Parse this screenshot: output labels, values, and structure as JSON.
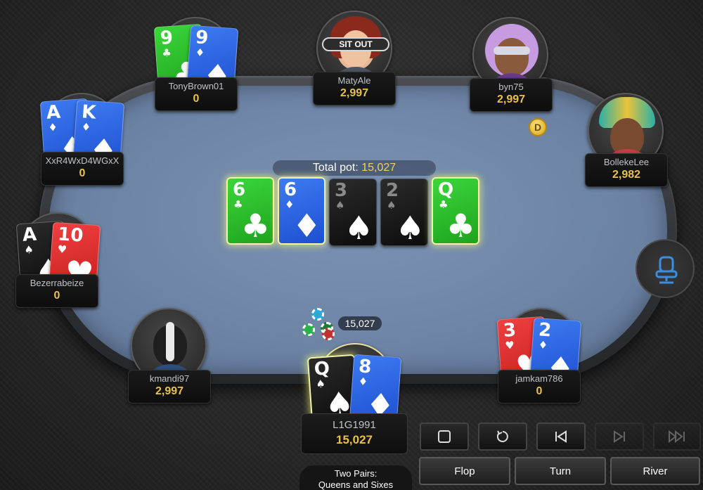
{
  "pot": {
    "label": "Total pot:",
    "value": "15,027"
  },
  "pot_chips_amount": "15,027",
  "board": [
    {
      "rank": "6",
      "suit": "♣",
      "suit_name": "clubs"
    },
    {
      "rank": "6",
      "suit": "♦",
      "suit_name": "diamonds"
    },
    {
      "rank": "3",
      "suit": "♠",
      "suit_name": "spades"
    },
    {
      "rank": "2",
      "suit": "♠",
      "suit_name": "spades"
    },
    {
      "rank": "Q",
      "suit": "♣",
      "suit_name": "clubs"
    }
  ],
  "players": {
    "tonybrown": {
      "name": "TonyBrown01",
      "stack": "0",
      "cards": [
        {
          "rank": "9",
          "suit": "♣"
        },
        {
          "rank": "9",
          "suit": "♦"
        }
      ]
    },
    "matyale": {
      "name": "MatyAle",
      "stack": "2,997",
      "status": "SIT OUT"
    },
    "byn75": {
      "name": "byn75",
      "stack": "2,997"
    },
    "bollekelee": {
      "name": "BollekeLee",
      "stack": "2,982"
    },
    "xxr4": {
      "name": "XxR4WxD4WGxX",
      "stack": "0",
      "cards": [
        {
          "rank": "A",
          "suit": "♦"
        },
        {
          "rank": "K",
          "suit": "♦"
        }
      ]
    },
    "bezerra": {
      "name": "Bezerrabeize",
      "stack": "0",
      "cards": [
        {
          "rank": "A",
          "suit": "♠"
        },
        {
          "rank": "10",
          "suit": "♥"
        }
      ]
    },
    "kmandi": {
      "name": "kmandi97",
      "stack": "2,997"
    },
    "jamkam": {
      "name": "jamkam786",
      "stack": "0",
      "cards": [
        {
          "rank": "3",
          "suit": "♥"
        },
        {
          "rank": "2",
          "suit": "♦"
        }
      ]
    },
    "hero": {
      "name": "L1G1991",
      "stack": "15,027",
      "cards": [
        {
          "rank": "Q",
          "suit": "♠"
        },
        {
          "rank": "8",
          "suit": "♦"
        }
      ]
    }
  },
  "dealer_button": "D",
  "hand_description": {
    "line1": "Two Pairs:",
    "line2": "Queens and Sixes"
  },
  "controls": {
    "stop_icon": "stop-icon",
    "replay_icon": "replay-icon",
    "skip_back_icon": "skip-back-icon",
    "step_forward_icon": "step-forward-icon",
    "fast_forward_icon": "fast-forward-icon"
  },
  "streets": {
    "flop": "Flop",
    "turn": "Turn",
    "river": "River"
  },
  "colors": {
    "felt": "#6e85a6",
    "stack_gold": "#e8c14a",
    "highlight": "#f1f4a8"
  }
}
